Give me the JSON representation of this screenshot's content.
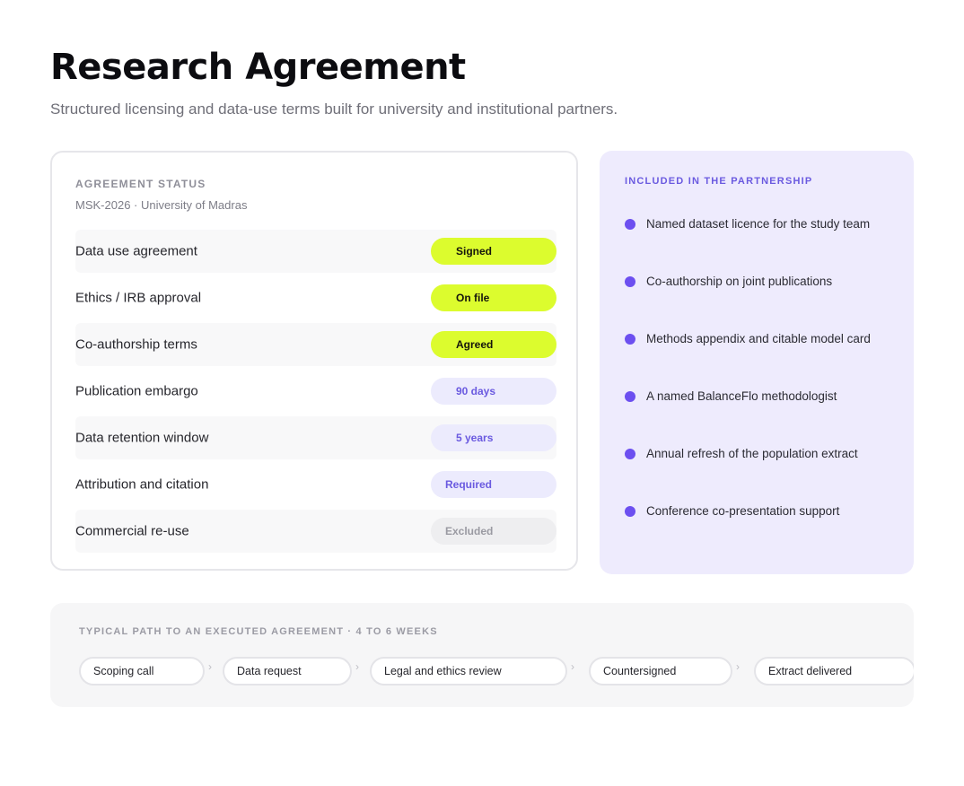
{
  "page": {
    "title": "Research Agreement",
    "subtitle": "Structured licensing and data-use terms built for university and institutional partners."
  },
  "status": {
    "eyebrow": "AGREEMENT STATUS",
    "meta": "MSK-2026 · University of Madras",
    "rows": [
      {
        "label": "Data use agreement",
        "value": "Signed"
      },
      {
        "label": "Ethics / IRB approval",
        "value": "On file"
      },
      {
        "label": "Co-authorship terms",
        "value": "Agreed"
      },
      {
        "label": "Publication embargo",
        "value": "90 days"
      },
      {
        "label": "Data retention window",
        "value": "5 years"
      },
      {
        "label": "Attribution and citation",
        "value": "Required"
      },
      {
        "label": "Commercial re-use",
        "value": "Excluded"
      }
    ]
  },
  "included": {
    "eyebrow": "INCLUDED IN THE PARTNERSHIP",
    "items": [
      "Named dataset licence for the study team",
      "Co-authorship on joint publications",
      "Methods appendix and citable model card",
      "A named BalanceFlo methodologist",
      "Annual refresh of the population extract",
      "Conference co-presentation support"
    ]
  },
  "path": {
    "eyebrow": "TYPICAL PATH TO AN EXECUTED AGREEMENT · 4 TO 6 WEEKS",
    "steps": [
      "Scoping call",
      "Data request",
      "Legal and ethics review",
      "Countersigned",
      "Extract delivered"
    ],
    "separator": "›"
  },
  "colors": {
    "accent_lime": "#dcfc2e",
    "accent_purple": "#6c4ff0",
    "panel_lavender": "#eeebfd"
  }
}
